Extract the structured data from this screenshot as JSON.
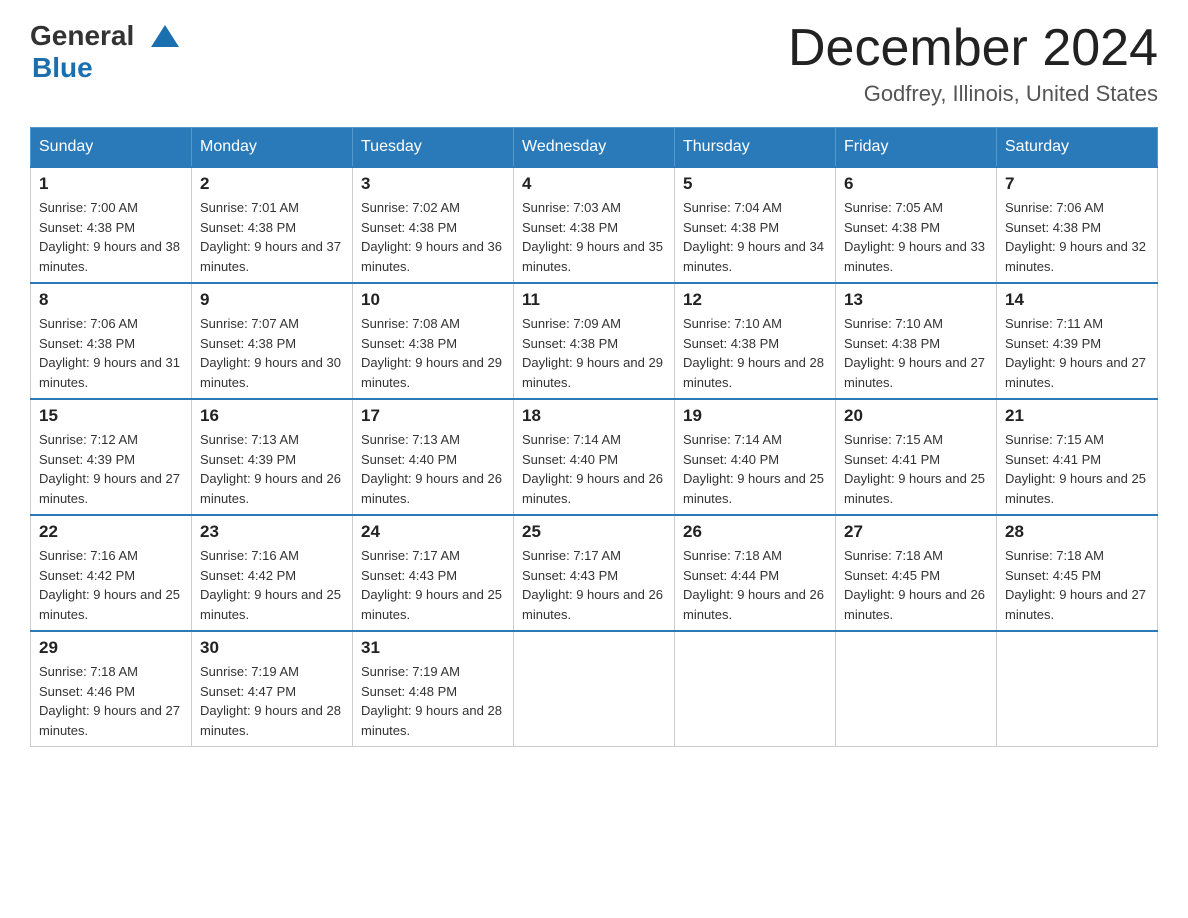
{
  "logo": {
    "text_general": "General",
    "triangle_symbol": "▲",
    "text_blue": "Blue"
  },
  "title": "December 2024",
  "subtitle": "Godfrey, Illinois, United States",
  "weekdays": [
    "Sunday",
    "Monday",
    "Tuesday",
    "Wednesday",
    "Thursday",
    "Friday",
    "Saturday"
  ],
  "weeks": [
    [
      {
        "day": "1",
        "sunrise": "7:00 AM",
        "sunset": "4:38 PM",
        "daylight": "9 hours and 38 minutes."
      },
      {
        "day": "2",
        "sunrise": "7:01 AM",
        "sunset": "4:38 PM",
        "daylight": "9 hours and 37 minutes."
      },
      {
        "day": "3",
        "sunrise": "7:02 AM",
        "sunset": "4:38 PM",
        "daylight": "9 hours and 36 minutes."
      },
      {
        "day": "4",
        "sunrise": "7:03 AM",
        "sunset": "4:38 PM",
        "daylight": "9 hours and 35 minutes."
      },
      {
        "day": "5",
        "sunrise": "7:04 AM",
        "sunset": "4:38 PM",
        "daylight": "9 hours and 34 minutes."
      },
      {
        "day": "6",
        "sunrise": "7:05 AM",
        "sunset": "4:38 PM",
        "daylight": "9 hours and 33 minutes."
      },
      {
        "day": "7",
        "sunrise": "7:06 AM",
        "sunset": "4:38 PM",
        "daylight": "9 hours and 32 minutes."
      }
    ],
    [
      {
        "day": "8",
        "sunrise": "7:06 AM",
        "sunset": "4:38 PM",
        "daylight": "9 hours and 31 minutes."
      },
      {
        "day": "9",
        "sunrise": "7:07 AM",
        "sunset": "4:38 PM",
        "daylight": "9 hours and 30 minutes."
      },
      {
        "day": "10",
        "sunrise": "7:08 AM",
        "sunset": "4:38 PM",
        "daylight": "9 hours and 29 minutes."
      },
      {
        "day": "11",
        "sunrise": "7:09 AM",
        "sunset": "4:38 PM",
        "daylight": "9 hours and 29 minutes."
      },
      {
        "day": "12",
        "sunrise": "7:10 AM",
        "sunset": "4:38 PM",
        "daylight": "9 hours and 28 minutes."
      },
      {
        "day": "13",
        "sunrise": "7:10 AM",
        "sunset": "4:38 PM",
        "daylight": "9 hours and 27 minutes."
      },
      {
        "day": "14",
        "sunrise": "7:11 AM",
        "sunset": "4:39 PM",
        "daylight": "9 hours and 27 minutes."
      }
    ],
    [
      {
        "day": "15",
        "sunrise": "7:12 AM",
        "sunset": "4:39 PM",
        "daylight": "9 hours and 27 minutes."
      },
      {
        "day": "16",
        "sunrise": "7:13 AM",
        "sunset": "4:39 PM",
        "daylight": "9 hours and 26 minutes."
      },
      {
        "day": "17",
        "sunrise": "7:13 AM",
        "sunset": "4:40 PM",
        "daylight": "9 hours and 26 minutes."
      },
      {
        "day": "18",
        "sunrise": "7:14 AM",
        "sunset": "4:40 PM",
        "daylight": "9 hours and 26 minutes."
      },
      {
        "day": "19",
        "sunrise": "7:14 AM",
        "sunset": "4:40 PM",
        "daylight": "9 hours and 25 minutes."
      },
      {
        "day": "20",
        "sunrise": "7:15 AM",
        "sunset": "4:41 PM",
        "daylight": "9 hours and 25 minutes."
      },
      {
        "day": "21",
        "sunrise": "7:15 AM",
        "sunset": "4:41 PM",
        "daylight": "9 hours and 25 minutes."
      }
    ],
    [
      {
        "day": "22",
        "sunrise": "7:16 AM",
        "sunset": "4:42 PM",
        "daylight": "9 hours and 25 minutes."
      },
      {
        "day": "23",
        "sunrise": "7:16 AM",
        "sunset": "4:42 PM",
        "daylight": "9 hours and 25 minutes."
      },
      {
        "day": "24",
        "sunrise": "7:17 AM",
        "sunset": "4:43 PM",
        "daylight": "9 hours and 25 minutes."
      },
      {
        "day": "25",
        "sunrise": "7:17 AM",
        "sunset": "4:43 PM",
        "daylight": "9 hours and 26 minutes."
      },
      {
        "day": "26",
        "sunrise": "7:18 AM",
        "sunset": "4:44 PM",
        "daylight": "9 hours and 26 minutes."
      },
      {
        "day": "27",
        "sunrise": "7:18 AM",
        "sunset": "4:45 PM",
        "daylight": "9 hours and 26 minutes."
      },
      {
        "day": "28",
        "sunrise": "7:18 AM",
        "sunset": "4:45 PM",
        "daylight": "9 hours and 27 minutes."
      }
    ],
    [
      {
        "day": "29",
        "sunrise": "7:18 AM",
        "sunset": "4:46 PM",
        "daylight": "9 hours and 27 minutes."
      },
      {
        "day": "30",
        "sunrise": "7:19 AM",
        "sunset": "4:47 PM",
        "daylight": "9 hours and 28 minutes."
      },
      {
        "day": "31",
        "sunrise": "7:19 AM",
        "sunset": "4:48 PM",
        "daylight": "9 hours and 28 minutes."
      },
      null,
      null,
      null,
      null
    ]
  ],
  "labels": {
    "sunrise_prefix": "Sunrise: ",
    "sunset_prefix": "Sunset: ",
    "daylight_prefix": "Daylight: "
  },
  "colors": {
    "header_bg": "#2a7aba",
    "header_text": "#ffffff",
    "border": "#2a7aba"
  }
}
